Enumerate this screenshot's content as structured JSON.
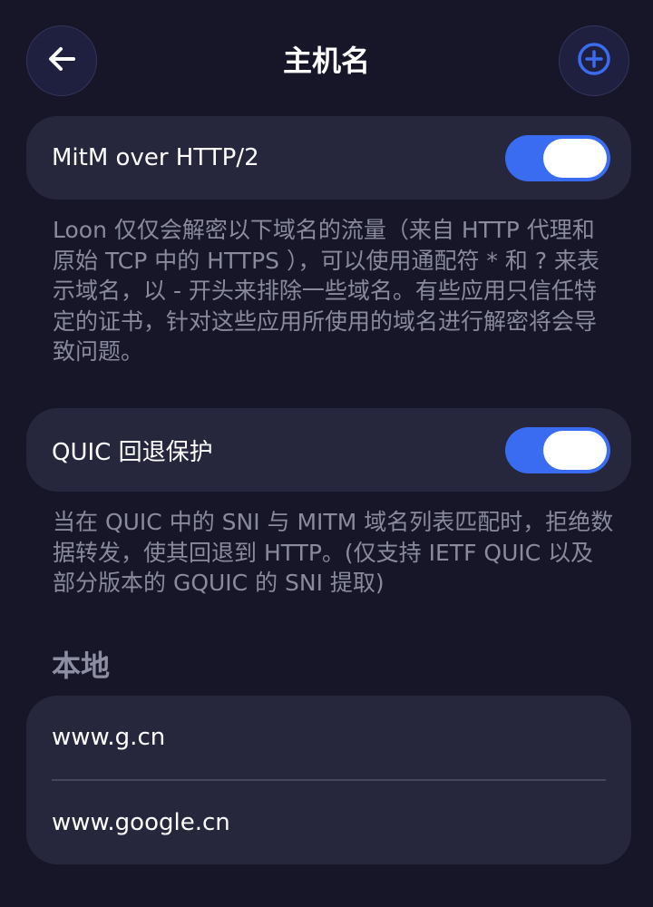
{
  "header": {
    "title": "主机名",
    "back_icon": "arrow-left-icon",
    "add_icon": "plus-circle-icon",
    "accent": "#3a6cf2"
  },
  "settings": [
    {
      "label": "MitM over HTTP/2",
      "enabled": true,
      "description": "Loon 仅仅会解密以下域名的流量（来自 HTTP 代理和原始 TCP 中的 HTTPS ），可以使用通配符 * 和 ? 来表示域名，以 - 开头来排除一些域名。有些应用只信任特定的证书，针对这些应用所使用的域名进行解密将会导致问题。"
    },
    {
      "label": "QUIC 回退保护",
      "enabled": true,
      "description": "当在 QUIC 中的 SNI 与 MITM 域名列表匹配时，拒绝数据转发，使其回退到 HTTP。(仅支持 IETF QUIC 以及部分版本的 GQUIC 的 SNI 提取)"
    }
  ],
  "local": {
    "title": "本地",
    "items": [
      "www.g.cn",
      "www.google.cn"
    ]
  }
}
